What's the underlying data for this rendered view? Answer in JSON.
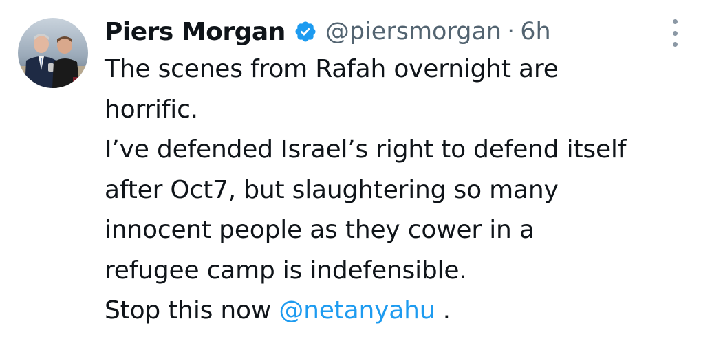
{
  "tweet": {
    "author_name": "Piers Morgan",
    "handle": "@piersmorgan",
    "separator": "·",
    "time": "6h",
    "verified_color": "#1d9bf0",
    "lines": [
      "The scenes from Rafah overnight are",
      "horrific.",
      "I’ve defended Israel’s right to defend itself",
      "after Oct7, but slaughtering so many",
      "innocent people as they cower in a",
      "refugee camp is indefensible."
    ],
    "last_line_prefix": "Stop this now ",
    "mention": "@netanyahu",
    "last_line_suffix": " .",
    "mention_color": "#1d9bf0"
  }
}
